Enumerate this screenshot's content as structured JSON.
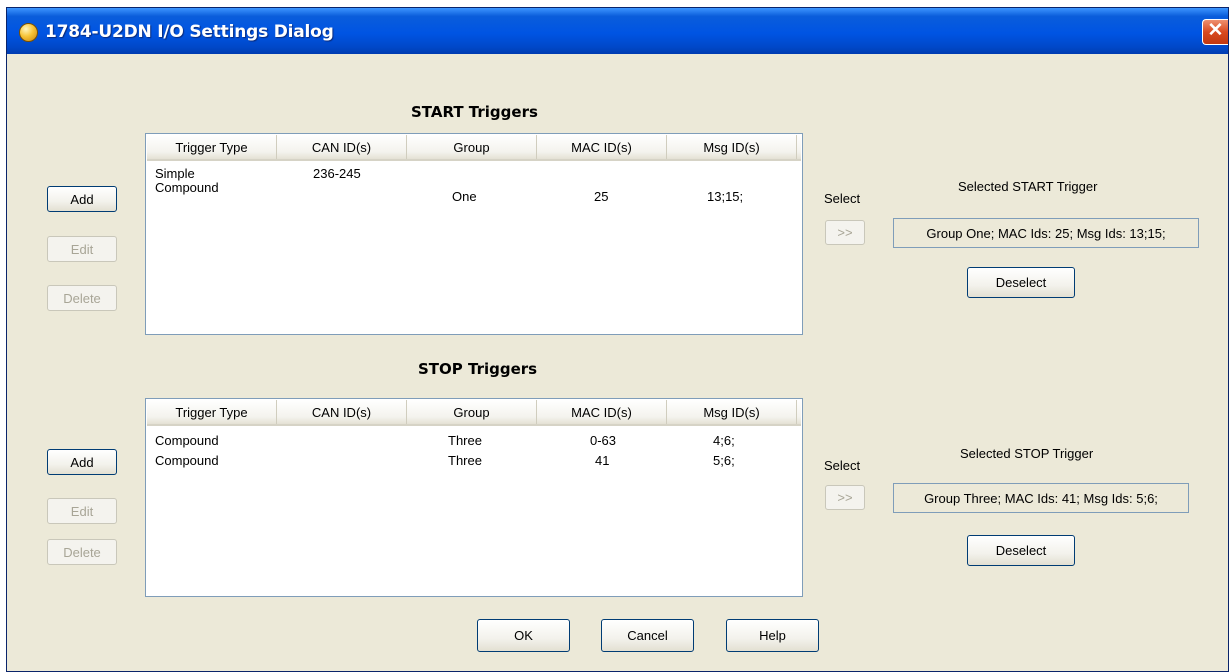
{
  "window": {
    "title": "1784-U2DN I/O Settings Dialog",
    "close_glyph": "✕"
  },
  "columns": [
    "Trigger Type",
    "CAN ID(s)",
    "Group",
    "MAC ID(s)",
    "Msg ID(s)"
  ],
  "start": {
    "title": "START Triggers",
    "rows": [
      {
        "type": "Simple",
        "can": "236-245",
        "group": "",
        "mac": "",
        "msg": ""
      },
      {
        "type": "Compound",
        "can": "",
        "group": "One",
        "mac": "25",
        "msg": "13;15;"
      }
    ],
    "select_label": "Select",
    "select_button": ">>",
    "selected_label": "Selected START Trigger",
    "selected_value": "Group One; MAC Ids: 25; Msg Ids: 13;15;",
    "deselect": "Deselect"
  },
  "stop": {
    "title": "STOP Triggers",
    "rows": [
      {
        "type": "Compound",
        "can": "",
        "group": "Three",
        "mac": "0-63",
        "msg": "4;6;"
      },
      {
        "type": "Compound",
        "can": "",
        "group": "Three",
        "mac": "41",
        "msg": "5;6;"
      }
    ],
    "select_label": "Select",
    "select_button": ">>",
    "selected_label": "Selected STOP Trigger",
    "selected_value": "Group Three; MAC Ids: 41; Msg Ids: 5;6;",
    "deselect": "Deselect"
  },
  "side_buttons": {
    "add": "Add",
    "edit": "Edit",
    "delete": "Delete"
  },
  "footer": {
    "ok": "OK",
    "cancel": "Cancel",
    "help": "Help"
  }
}
